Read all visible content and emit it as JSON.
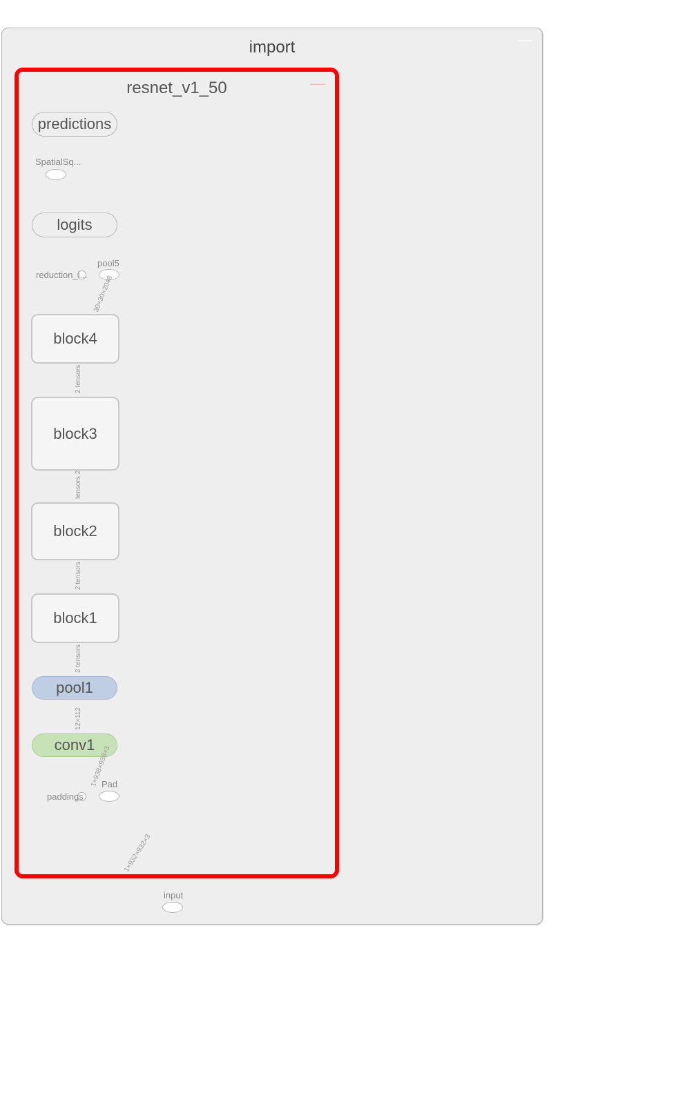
{
  "outer": {
    "title": "import",
    "collapse": "—"
  },
  "inner": {
    "title": "resnet_v1_50",
    "collapse": "—"
  },
  "nodes": {
    "predictions": "predictions",
    "logits": "logits",
    "block4": "block4",
    "block3": "block3",
    "block2": "block2",
    "block1": "block1",
    "pool1": "pool1",
    "conv1": "conv1"
  },
  "ops": {
    "spatial": "SpatialSq...",
    "pool5": "pool5",
    "pad": "Pad",
    "input": "input"
  },
  "consts": {
    "reduction": "reduction_i...",
    "paddings": "paddings"
  },
  "edges": {
    "input_pad": "1×932×932×3",
    "pad_conv1": "1×938×938×3",
    "conv1_pool1": "12×112",
    "pool1_block1": "2 tensors",
    "block1_block2": "2 tensors",
    "block2_block3": "tensors 2",
    "block3_block4": "2 tensors",
    "block4_pool5": "30×30×2048"
  }
}
